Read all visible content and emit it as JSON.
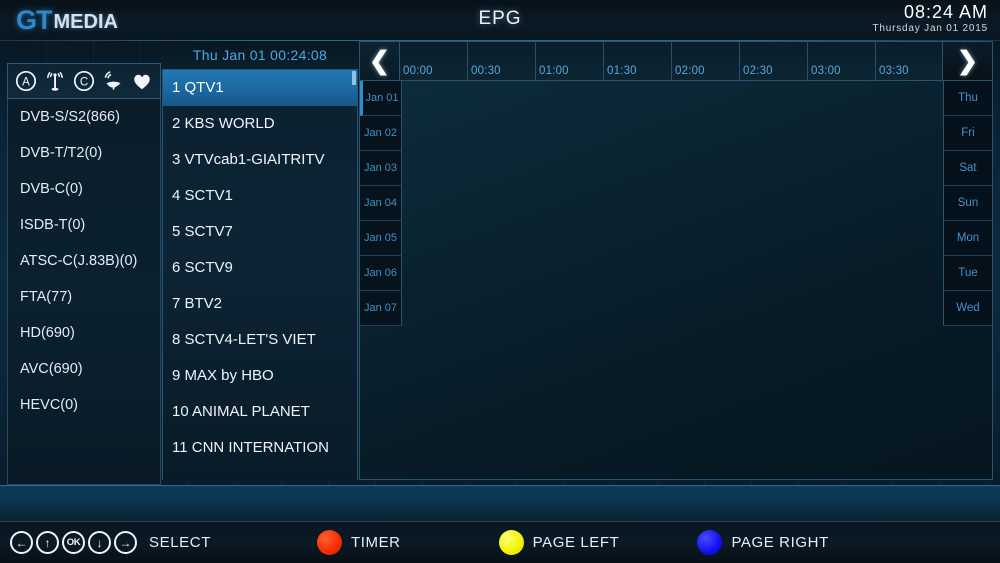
{
  "header": {
    "logo_gt": "GT",
    "logo_media": "MEDIA",
    "title": "EPG",
    "clock_time": "08:24  AM",
    "clock_date": "Thursday  Jan 01 2015"
  },
  "tuner_icons": [
    {
      "name": "circled-a-icon",
      "label": "A"
    },
    {
      "name": "antenna-icon",
      "label": "Antenna"
    },
    {
      "name": "circled-c-icon",
      "label": "C"
    },
    {
      "name": "satellite-dish-icon",
      "label": "Satellite"
    },
    {
      "name": "heart-icon",
      "label": "Favorite"
    }
  ],
  "filters": [
    {
      "label": "DVB-S/S2(866)"
    },
    {
      "label": "DVB-T/T2(0)"
    },
    {
      "label": "DVB-C(0)"
    },
    {
      "label": "ISDB-T(0)"
    },
    {
      "label": "ATSC-C(J.83B)(0)"
    },
    {
      "label": "FTA(77)"
    },
    {
      "label": "HD(690)"
    },
    {
      "label": "AVC(690)"
    },
    {
      "label": "HEVC(0)"
    }
  ],
  "channels": {
    "header": "Thu Jan 01 00:24:08",
    "selected_index": 0,
    "items": [
      {
        "label": "1 QTV1"
      },
      {
        "label": "2 KBS WORLD"
      },
      {
        "label": "3 VTVcab1-GIAITRITV"
      },
      {
        "label": "4 SCTV1"
      },
      {
        "label": "5 SCTV7"
      },
      {
        "label": "6 SCTV9"
      },
      {
        "label": "7 BTV2"
      },
      {
        "label": "8 SCTV4-LET'S VIET"
      },
      {
        "label": "9 MAX by HBO"
      },
      {
        "label": "10 ANIMAL PLANET"
      },
      {
        "label": "11 CNN INTERNATION"
      }
    ]
  },
  "timeline": {
    "prev_label": "❮",
    "next_label": "❯",
    "slots": [
      {
        "label": "00:00"
      },
      {
        "label": "00:30"
      },
      {
        "label": "01:00"
      },
      {
        "label": "01:30"
      },
      {
        "label": "02:00"
      },
      {
        "label": "02:30"
      },
      {
        "label": "03:00"
      },
      {
        "label": "03:30"
      }
    ]
  },
  "dates": [
    {
      "label": "Jan 01",
      "active": true
    },
    {
      "label": "Jan 02",
      "active": false
    },
    {
      "label": "Jan 03",
      "active": false
    },
    {
      "label": "Jan 04",
      "active": false
    },
    {
      "label": "Jan 05",
      "active": false
    },
    {
      "label": "Jan 06",
      "active": false
    },
    {
      "label": "Jan 07",
      "active": false
    }
  ],
  "days": [
    {
      "label": "Thu"
    },
    {
      "label": "Fri"
    },
    {
      "label": "Sat"
    },
    {
      "label": "Sun"
    },
    {
      "label": "Mon"
    },
    {
      "label": "Tue"
    },
    {
      "label": "Wed"
    }
  ],
  "footer": {
    "select_keys": [
      "←",
      "↑",
      "OK",
      "↓",
      "→"
    ],
    "select_label": "SELECT",
    "timer_label": "TIMER",
    "page_left_label": "PAGE LEFT",
    "page_right_label": "PAGE RIGHT",
    "timer_color": "#f22d00",
    "page_left_color": "#f2f200",
    "page_right_color": "#1111f0"
  }
}
